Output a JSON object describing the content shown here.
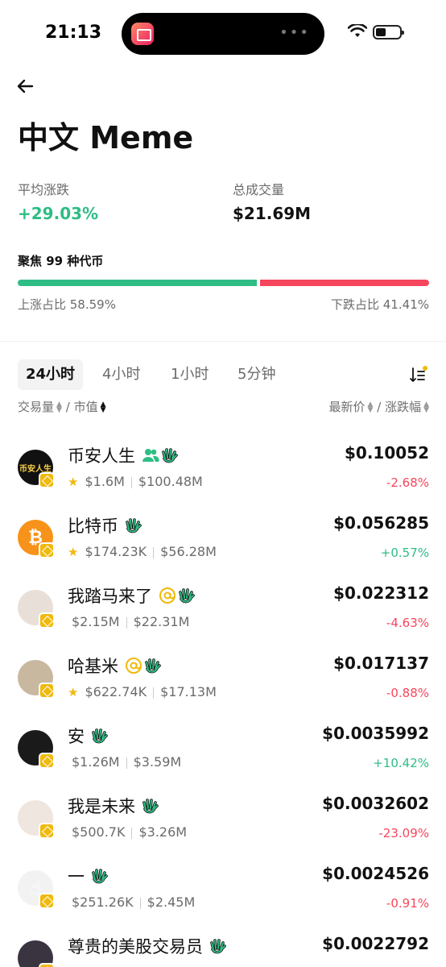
{
  "status": {
    "time": "21:13",
    "island_dots": "•••"
  },
  "header": {
    "title": "中文 Meme"
  },
  "stats": {
    "avg_change_label": "平均涨跌",
    "avg_change_value": "+29.03%",
    "volume_label": "总成交量",
    "volume_value": "$21.69M"
  },
  "focus": "聚焦 99 种代币",
  "ratio": {
    "up_label": "上涨占比 58.59%",
    "down_label": "下跌占比 41.41%",
    "up_fraction": 0.5859,
    "down_fraction": 0.4141,
    "up_color": "#2ebd85",
    "down_color": "#f6465d"
  },
  "tabs": [
    "24小时",
    "4小时",
    "1小时",
    "5分钟"
  ],
  "columns": {
    "left": [
      "交易量",
      "市值"
    ],
    "right": [
      "最新价",
      "涨跌幅"
    ],
    "sep": "/"
  },
  "tokens": [
    {
      "name": "币安人生",
      "icons": [
        "users-icon",
        "wave-icon"
      ],
      "starred": true,
      "volume": "$1.6M",
      "mcap": "$100.48M",
      "price": "$0.10052",
      "change": "-2.68%",
      "direction": "down"
    },
    {
      "name": "比特币",
      "icons": [
        "wave-icon"
      ],
      "starred": true,
      "volume": "$174.23K",
      "mcap": "$56.28M",
      "price": "$0.056285",
      "change": "+0.57%",
      "direction": "up"
    },
    {
      "name": "我踏马来了",
      "icons": [
        "at-icon",
        "wave-icon"
      ],
      "starred": false,
      "volume": "$2.15M",
      "mcap": "$22.31M",
      "price": "$0.022312",
      "change": "-4.63%",
      "direction": "down"
    },
    {
      "name": "哈基米",
      "icons": [
        "at-icon",
        "wave-icon"
      ],
      "starred": true,
      "volume": "$622.74K",
      "mcap": "$17.13M",
      "price": "$0.017137",
      "change": "-0.88%",
      "direction": "down"
    },
    {
      "name": "安",
      "icons": [
        "wave-icon"
      ],
      "starred": false,
      "volume": "$1.26M",
      "mcap": "$3.59M",
      "price": "$0.0035992",
      "change": "+10.42%",
      "direction": "up"
    },
    {
      "name": "我是未来",
      "icons": [
        "wave-icon"
      ],
      "starred": false,
      "volume": "$500.7K",
      "mcap": "$3.26M",
      "price": "$0.0032602",
      "change": "-23.09%",
      "direction": "down"
    },
    {
      "name": "一",
      "icons": [
        "wave-icon"
      ],
      "starred": false,
      "volume": "$251.26K",
      "mcap": "$2.45M",
      "price": "$0.0024526",
      "change": "-0.91%",
      "direction": "down"
    },
    {
      "name": "尊贵的美股交易员",
      "icons": [
        "wave-icon"
      ],
      "starred": false,
      "volume": "",
      "mcap": "",
      "price": "$0.0022792",
      "change": "",
      "direction": "down"
    }
  ],
  "avatar_colors": [
    "#111111",
    "#f7931a",
    "#e8e0d8",
    "#c9b8a0",
    "#1a1a1a",
    "#efe6df",
    "#f2f2f2",
    "#3a3340"
  ],
  "avatar_texts": [
    "币安人生",
    "₿",
    "",
    "",
    "",
    "",
    "☝",
    ""
  ]
}
